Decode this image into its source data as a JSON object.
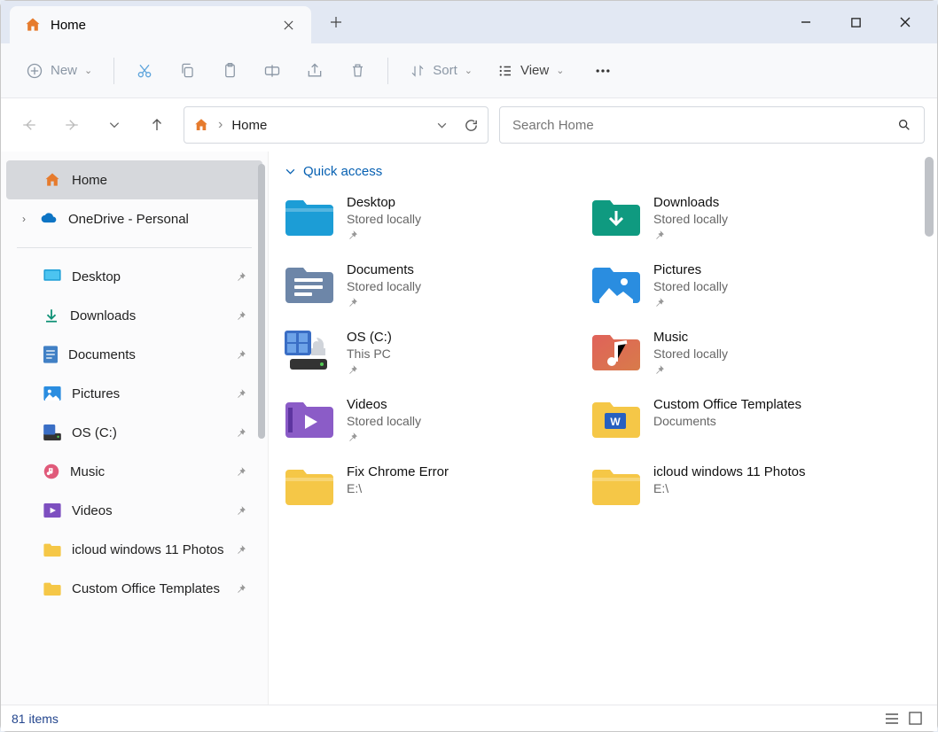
{
  "tab": {
    "title": "Home"
  },
  "toolbar": {
    "new": "New",
    "sort": "Sort",
    "view": "View"
  },
  "address": {
    "location": "Home"
  },
  "search": {
    "placeholder": "Search Home"
  },
  "sidebar": {
    "home": "Home",
    "onedrive": "OneDrive - Personal",
    "items": [
      {
        "label": "Desktop",
        "icon": "desktop"
      },
      {
        "label": "Downloads",
        "icon": "downloads"
      },
      {
        "label": "Documents",
        "icon": "documents"
      },
      {
        "label": "Pictures",
        "icon": "pictures"
      },
      {
        "label": "OS (C:)",
        "icon": "drive"
      },
      {
        "label": "Music",
        "icon": "music"
      },
      {
        "label": "Videos",
        "icon": "videos"
      },
      {
        "label": "icloud windows 11 Photos",
        "icon": "folder"
      },
      {
        "label": "Custom Office Templates",
        "icon": "folder"
      }
    ]
  },
  "content": {
    "section": "Quick access",
    "items": [
      {
        "name": "Desktop",
        "sub": "Stored locally",
        "pinned": true,
        "color": "#1c9dd6"
      },
      {
        "name": "Downloads",
        "sub": "Stored locally",
        "pinned": true,
        "color": "#0f9a80"
      },
      {
        "name": "Documents",
        "sub": "Stored locally",
        "pinned": true,
        "color": "#6d86a8"
      },
      {
        "name": "Pictures",
        "sub": "Stored locally",
        "pinned": true,
        "color": "#2a8de0"
      },
      {
        "name": "OS (C:)",
        "sub": "This PC",
        "pinned": true,
        "color": "#4169c5"
      },
      {
        "name": "Music",
        "sub": "Stored locally",
        "pinned": true,
        "color": "#e0625a"
      },
      {
        "name": "Videos",
        "sub": "Stored locally",
        "pinned": true,
        "color": "#8b5cc7"
      },
      {
        "name": "Custom Office Templates",
        "sub": "Documents",
        "pinned": false,
        "color": "#f5c747"
      },
      {
        "name": "Fix Chrome Error",
        "sub": "E:\\",
        "pinned": false,
        "color": "#f5c747"
      },
      {
        "name": "icloud windows 11 Photos",
        "sub": "E:\\",
        "pinned": false,
        "color": "#f5c747"
      }
    ]
  },
  "status": {
    "count": "81 items"
  }
}
